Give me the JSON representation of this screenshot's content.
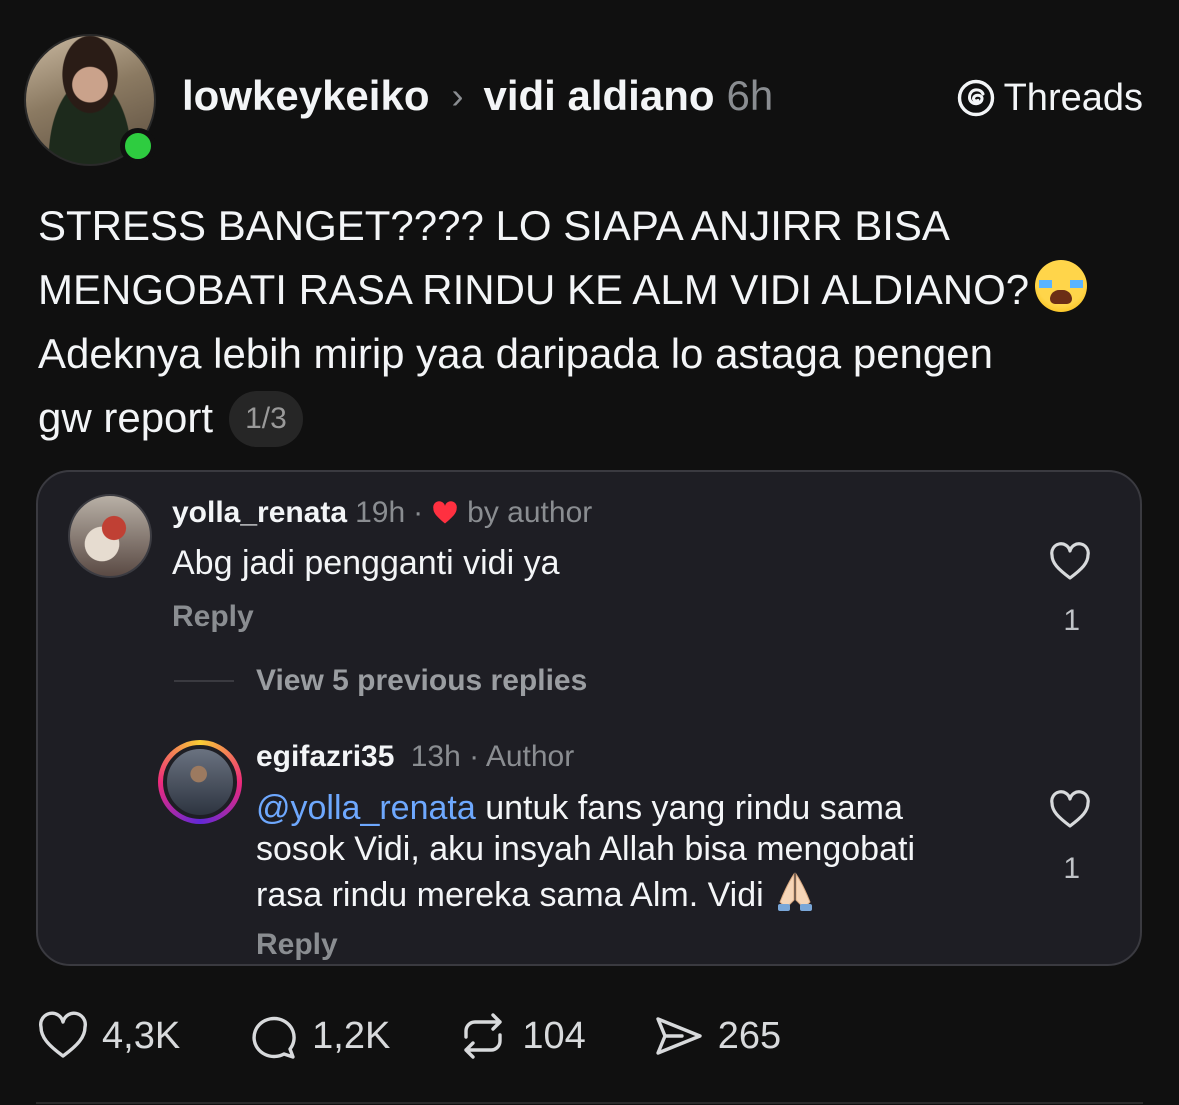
{
  "header": {
    "username": "lowkeykeiko",
    "separator": "›",
    "target": "vidi aldiano",
    "time": "6h",
    "brand": "Threads"
  },
  "post": {
    "line1": "STRESS BANGET???? LO SIAPA ANJIRR BISA",
    "line2": "MENGOBATI RASA RINDU KE ALM VIDI ALDIANO?",
    "line3": "Adeknya lebih mirip yaa daripada lo astaga pengen",
    "line4": "gw report",
    "page_indicator": "1/3"
  },
  "quoted": {
    "comment": {
      "username": "yolla_renata",
      "time": "19h",
      "dot": "·",
      "liked_by": "by author",
      "text": "Abg jadi pengganti vidi ya",
      "reply_label": "Reply",
      "likes": "1"
    },
    "view_previous": "View 5 previous replies",
    "reply": {
      "username": "egifazri35",
      "time": "13h",
      "role": "· Author",
      "mention": "@yolla_renata",
      "text_part1": " untuk fans yang rindu sama",
      "text_part2": "sosok Vidi, aku insyah Allah bisa mengobati",
      "text_part3": "rasa rindu mereka sama Alm. Vidi",
      "reply_label": "Reply",
      "likes": "1"
    }
  },
  "actions": {
    "likes": "4,3K",
    "comments": "1,2K",
    "reposts": "104",
    "shares": "265"
  },
  "icons": {
    "brand": "threads-logo-icon",
    "like": "heart-icon",
    "comment": "comment-bubble-icon",
    "repost": "repost-icon",
    "share": "send-icon",
    "author_like": "red-heart-icon",
    "emoji_cry": "loudly-crying-face-emoji",
    "emoji_pray": "folded-hands-emoji"
  },
  "colors": {
    "background": "#101010",
    "card": "#1e1e24",
    "mention": "#6ea8fe",
    "heart": "#ff3040",
    "online": "#2ecc40"
  }
}
